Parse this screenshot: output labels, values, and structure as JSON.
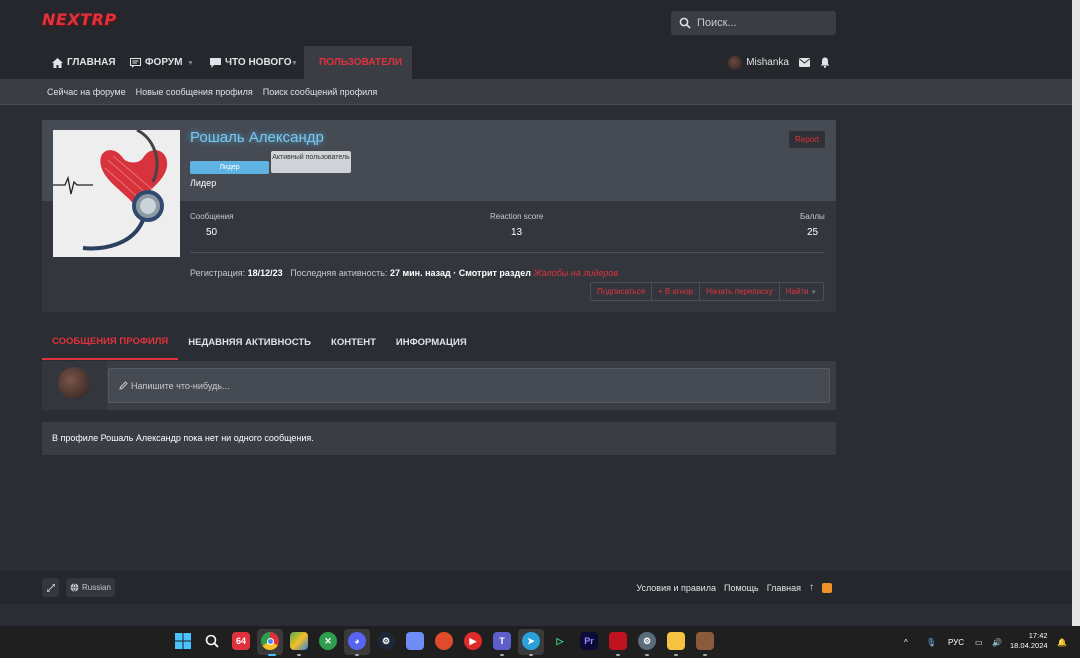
{
  "site": {
    "logo_text": "NEXTRP"
  },
  "search": {
    "placeholder": "Поиск..."
  },
  "nav": {
    "tabs": [
      {
        "label": "Главная"
      },
      {
        "label": "Форум"
      },
      {
        "label": "Что нового"
      },
      {
        "label": "Пользователи"
      }
    ],
    "username": "Mishanka"
  },
  "subnav": {
    "items": [
      "Сейчас на форуме",
      "Новые сообщения профиля",
      "Поиск сообщений профиля"
    ]
  },
  "profile": {
    "name": "Рошаль Александр",
    "badge_role": "Лидер",
    "badge_active": "Активный пользователь",
    "title": "Лидер",
    "report": "Report",
    "stats": [
      {
        "label": "Сообщения",
        "value": "50"
      },
      {
        "label": "Reaction score",
        "value": "13"
      },
      {
        "label": "Баллы",
        "value": "25"
      }
    ],
    "reg_label": "Регистрация:",
    "reg_date": "18/12/23",
    "activity_label": "Последняя активность:",
    "activity_value": "27 мин. назад · Смотрит раздел",
    "activity_section": "Жалобы на лидеров",
    "actions": [
      "Подписаться",
      "+ В игнор",
      "Начать переписку",
      "Найти"
    ]
  },
  "tabs": [
    "Сообщения профиля",
    "Недавняя активность",
    "Контент",
    "Информация"
  ],
  "compose": {
    "placeholder": "Напишите что-нибудь..."
  },
  "empty_message": "В профиле Рошаль Александр пока нет ни одного сообщения.",
  "footer": {
    "language": "Russian",
    "links": [
      "Условия и правила",
      "Помощь",
      "Главная"
    ]
  },
  "taskbar": {
    "badge_64": "64",
    "lang": "РУС",
    "time": "17:42",
    "date": "18.04.2024"
  },
  "colors": {
    "accent": "#e0323c",
    "name": "#7cc7ee",
    "bg": "#2a2d33"
  }
}
